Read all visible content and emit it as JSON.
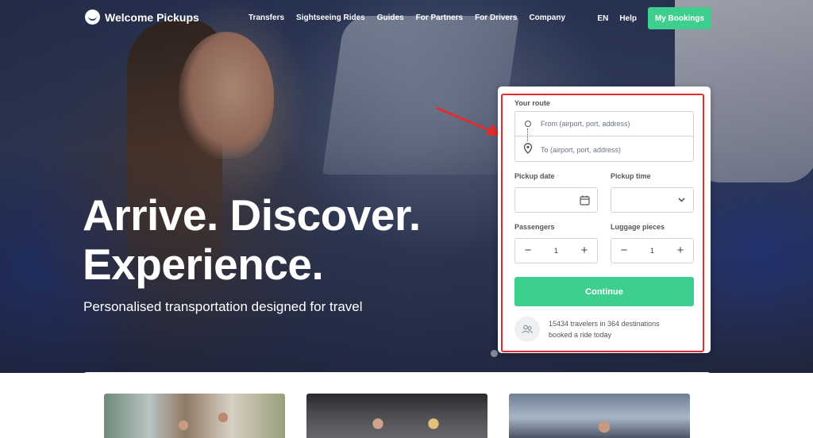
{
  "brand": {
    "name": "Welcome Pickups"
  },
  "nav": {
    "links": [
      "Transfers",
      "Sightseeing Rides",
      "Guides",
      "For Partners",
      "For Drivers",
      "Company"
    ],
    "language": "EN",
    "help": "Help",
    "bookings_button": "My Bookings"
  },
  "hero": {
    "headline_line1": "Arrive. Discover.",
    "headline_line2": "Experience.",
    "subheadline": "Personalised transportation designed for travel"
  },
  "booking": {
    "route_label": "Your route",
    "from_placeholder": "From (airport, port, address)",
    "to_placeholder": "To (airport, port, address)",
    "pickup_date_label": "Pickup date",
    "pickup_time_label": "Pickup time",
    "passengers_label": "Passengers",
    "passengers_value": "1",
    "luggage_label": "Luggage pieces",
    "luggage_value": "1",
    "continue_button": "Continue",
    "stats_line1": "15434 travelers in 364 destinations",
    "stats_line2": "booked a ride today"
  },
  "icons": {
    "logo": "logo-mark-icon",
    "from": "origin-circle-icon",
    "to": "location-pin-icon",
    "date": "calendar-icon",
    "time": "chevron-down-icon",
    "minus": "minus-icon",
    "plus": "plus-icon",
    "stats": "travelers-icon"
  },
  "colors": {
    "accent": "#3ecf8e",
    "annotation": "#e02c2c"
  }
}
